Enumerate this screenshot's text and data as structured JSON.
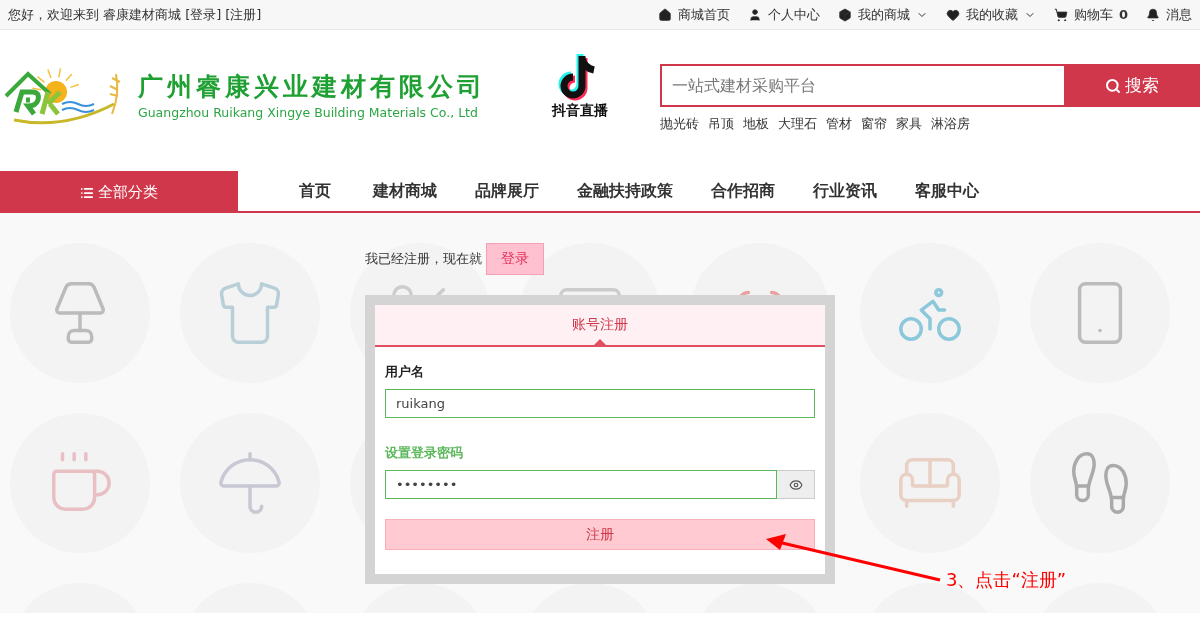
{
  "top_bar": {
    "greeting": "您好，欢迎来到 睿康建材商城",
    "login_link": "[登录]",
    "register_link": "[注册]",
    "links": [
      {
        "kind": "home",
        "label": "商城首页",
        "dropdown": false
      },
      {
        "kind": "user",
        "label": "个人中心",
        "dropdown": false
      },
      {
        "kind": "box",
        "label": "我的商城",
        "dropdown": true
      },
      {
        "kind": "heart",
        "label": "我的收藏",
        "dropdown": true
      },
      {
        "kind": "cart",
        "label": "购物车",
        "count": "0",
        "dropdown": false
      },
      {
        "kind": "bell",
        "label": "消息",
        "dropdown": false
      }
    ]
  },
  "header": {
    "company_name_cn": "广州睿康兴业建材有限公司",
    "company_name_en": "Guangzhou Ruikang Xingye Building Materials Co., Ltd",
    "live_label": "抖音直播",
    "search": {
      "placeholder": "一站式建材采购平台",
      "button": "搜索"
    },
    "hot_keywords": [
      "抛光砖",
      "吊顶",
      "地板",
      "大理石",
      "管材",
      "窗帘",
      "家具",
      "淋浴房"
    ]
  },
  "nav": {
    "category_button": "全部分类",
    "items": [
      "首页",
      "建材商城",
      "品牌展厅",
      "金融扶持政策",
      "合作招商",
      "行业资讯",
      "客服中心"
    ]
  },
  "login_prompt": {
    "text": "我已经注册，现在就",
    "button": "登录"
  },
  "form": {
    "tabs": [
      {
        "label": "账号注册",
        "selected": true
      }
    ],
    "fields": [
      {
        "label": "用户名",
        "value": "ruikang",
        "focused": false,
        "reveal_toggle": false
      },
      {
        "label": "设置登录密码",
        "value": "••••••••",
        "focused": true,
        "reveal_toggle": true
      }
    ],
    "submit": "注册"
  },
  "annotation": {
    "text": "3、点击“注册”"
  }
}
